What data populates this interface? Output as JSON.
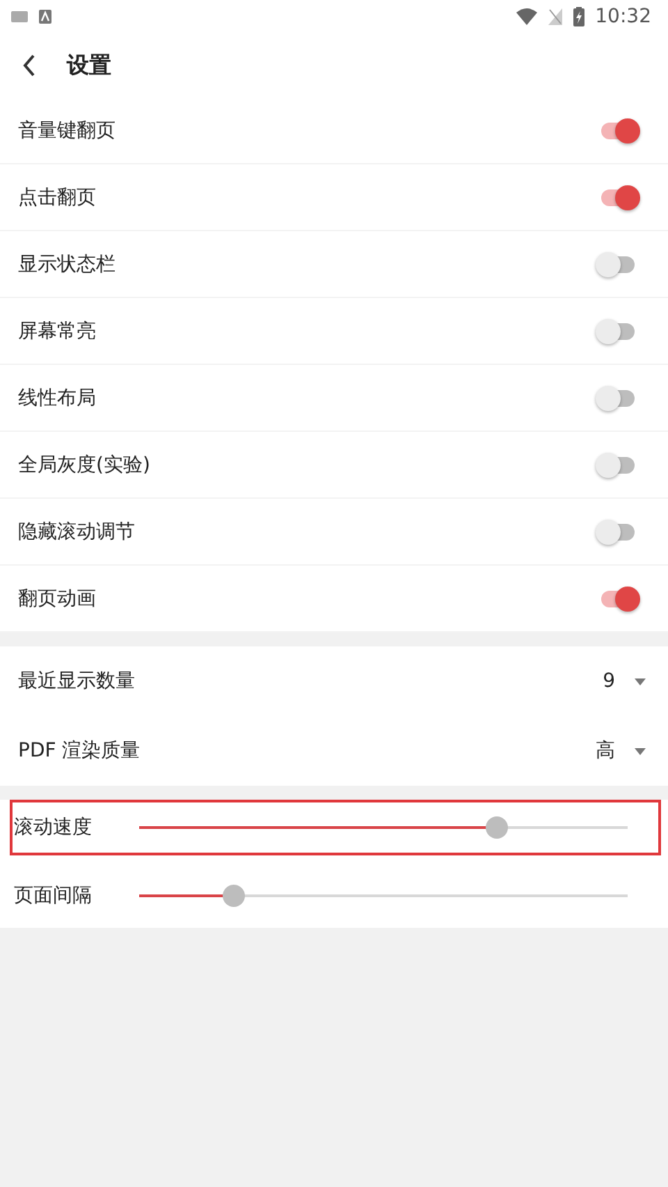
{
  "status_bar": {
    "time": "10:32"
  },
  "header": {
    "title": "设置"
  },
  "toggles": [
    {
      "label": "音量键翻页",
      "on": true
    },
    {
      "label": "点击翻页",
      "on": true
    },
    {
      "label": "显示状态栏",
      "on": false
    },
    {
      "label": "屏幕常亮",
      "on": false
    },
    {
      "label": "线性布局",
      "on": false
    },
    {
      "label": "全局灰度(实验)",
      "on": false
    },
    {
      "label": "隐藏滚动调节",
      "on": false
    },
    {
      "label": "翻页动画",
      "on": true
    }
  ],
  "dropdowns": [
    {
      "label": "最近显示数量",
      "value": "9"
    },
    {
      "label": "PDF 渲染质量",
      "value": "高"
    }
  ],
  "sliders": [
    {
      "label": "滚动速度",
      "level": 0.7,
      "highlighted": true
    },
    {
      "label": "页面间隔",
      "level": 0.185,
      "highlighted": false
    }
  ]
}
